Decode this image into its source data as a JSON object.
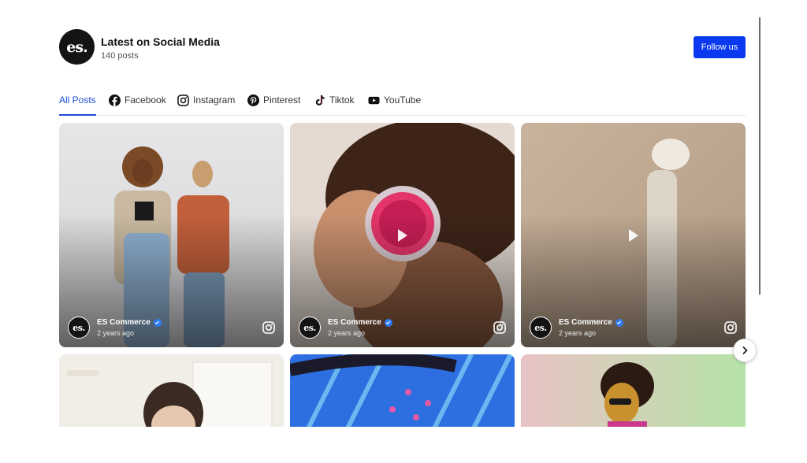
{
  "header": {
    "logo_text": "es.",
    "title": "Latest on Social Media",
    "post_count": "140 posts",
    "follow_label": "Follow us"
  },
  "tabs": [
    {
      "label": "All Posts",
      "icon": "none",
      "active": true
    },
    {
      "label": "Facebook",
      "icon": "facebook-icon",
      "active": false
    },
    {
      "label": "Instagram",
      "icon": "instagram-icon",
      "active": false
    },
    {
      "label": "Pinterest",
      "icon": "pinterest-icon",
      "active": false
    },
    {
      "label": "Tiktok",
      "icon": "tiktok-icon",
      "active": false
    },
    {
      "label": "YouTube",
      "icon": "youtube-icon",
      "active": false
    }
  ],
  "posts": [
    {
      "author": "ES Commerce",
      "avatar_text": "es.",
      "time": "2 years ago",
      "source_icon": "instagram-icon",
      "video": false
    },
    {
      "author": "ES Commerce",
      "avatar_text": "es.",
      "time": "2 years ago",
      "source_icon": "instagram-icon",
      "video": true
    },
    {
      "author": "ES Commerce",
      "avatar_text": "es.",
      "time": "2 years ago",
      "source_icon": "instagram-icon",
      "video": true
    }
  ],
  "colors": {
    "accent": "#0a39ef",
    "active_tab": "#1d4fd8",
    "verified": "#2d7bf4"
  },
  "carousel": {
    "next_icon": "chevron-right-icon"
  }
}
